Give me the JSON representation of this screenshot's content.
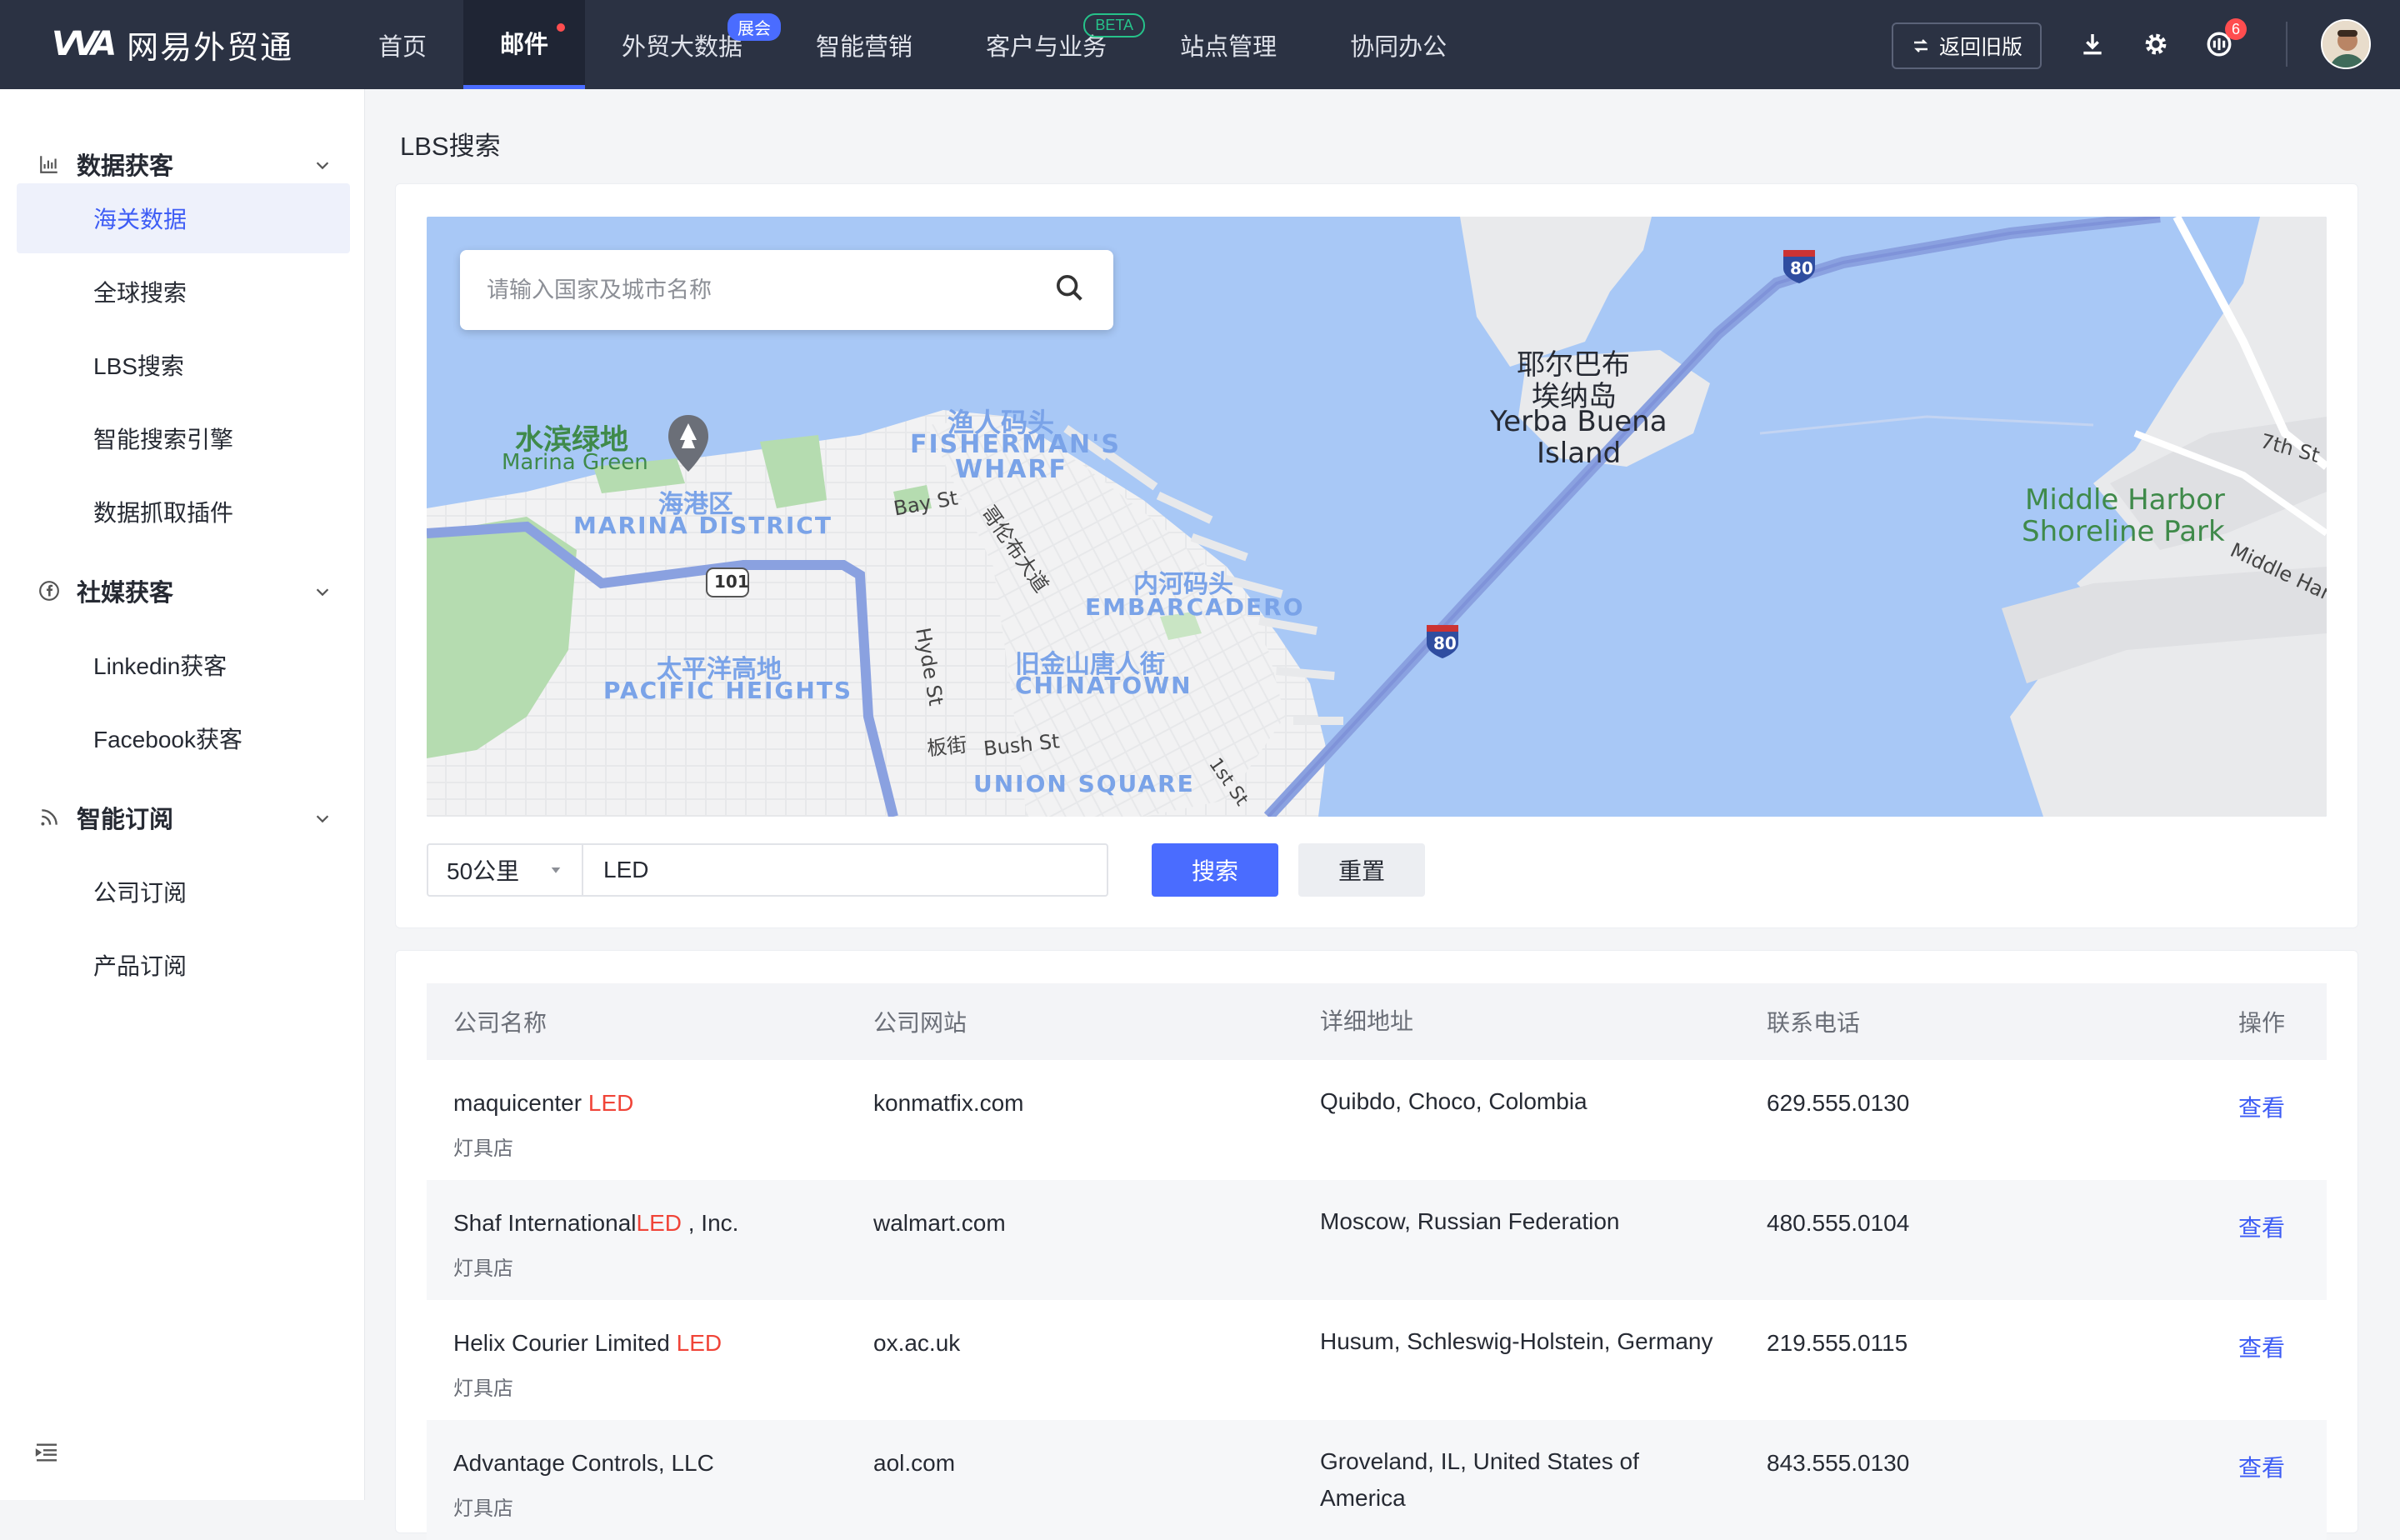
{
  "brand": {
    "logo_mark": "VVA",
    "name": "网易外贸通"
  },
  "nav": [
    {
      "label": "首页"
    },
    {
      "label": "邮件"
    },
    {
      "label": "外贸大数据",
      "badge": "展会"
    },
    {
      "label": "智能营销"
    },
    {
      "label": "客户与业务",
      "badge": "BETA"
    },
    {
      "label": "站点管理"
    },
    {
      "label": "协同办公"
    }
  ],
  "topbar": {
    "back_old_label": "返回旧版",
    "notification_count": "6"
  },
  "sidebar": {
    "groups": [
      {
        "title": "数据获客",
        "items": [
          "海关数据",
          "全球搜索",
          "LBS搜索",
          "智能搜索引擎",
          "数据抓取插件"
        ]
      },
      {
        "title": "社媒获客",
        "items": [
          "Linkedin获客",
          "Facebook获客"
        ]
      },
      {
        "title": "智能订阅",
        "items": [
          "公司订阅",
          "产品订阅"
        ]
      }
    ]
  },
  "page": {
    "title": "LBS搜索"
  },
  "map": {
    "search_placeholder": "请输入国家及城市名称",
    "labels": {
      "marina_green_cn": "水滨绿地",
      "marina_green_en": "Marina Green",
      "fishermans_cn": "渔人码头",
      "fishermans_en1": "FISHERMAN'S",
      "fishermans_en2": "WHARF",
      "marina_cn": "海港区",
      "marina_en": "MARINA DISTRICT",
      "bay_st": "Bay St",
      "columbus": "哥伦布大道",
      "embarcadero_cn": "内河码头",
      "embarcadero_en": "EMBARCADERO",
      "pacific_cn": "太平洋高地",
      "pacific_en": "PACIFIC HEIGHTS",
      "hyde_st": "Hyde St",
      "chinatown_cn": "旧金山唐人街",
      "chinatown_en": "CHINATOWN",
      "bush_cn": "板街",
      "bush_en": "Bush St",
      "union_en": "UNION SQUARE",
      "first_st": "1st St",
      "yerba_cn1": "耶尔巴布",
      "yerba_cn2": "埃纳岛",
      "yerba_en1": "Yerba Buena",
      "yerba_en2": "Island",
      "middle_harbor1": "Middle Harbor",
      "middle_harbor2": "Shoreline Park",
      "seventh_st": "7th St",
      "middle_har": "Middle Har",
      "hw101": "101",
      "hw80": "80"
    }
  },
  "filters": {
    "radius": "50公里",
    "keyword": "LED",
    "search_label": "搜索",
    "reset_label": "重置"
  },
  "table": {
    "headers": [
      "公司名称",
      "公司网站",
      "详细地址",
      "联系电话",
      "操作"
    ],
    "rows": [
      {
        "name_prefix": "maquicenter ",
        "name_hl": "LED",
        "name_suffix": "",
        "category": "灯具店",
        "website": "konmatfix.com",
        "address": "Quibdo, Choco, Colombia",
        "phone": "629.555.0130",
        "action": "查看"
      },
      {
        "name_prefix": "Shaf International",
        "name_hl": "LED",
        "name_suffix": " , Inc.",
        "category": "灯具店",
        "website": "walmart.com",
        "address": "Moscow, Russian Federation",
        "phone": "480.555.0104",
        "action": "查看"
      },
      {
        "name_prefix": "Helix Courier Limited ",
        "name_hl": "LED",
        "name_suffix": "",
        "category": "灯具店",
        "website": "ox.ac.uk",
        "address": "Husum, Schleswig-Holstein, Germany",
        "phone": "219.555.0115",
        "action": "查看"
      },
      {
        "name_prefix": "Advantage Controls, LLC",
        "name_hl": "",
        "name_suffix": "",
        "category": "灯具店",
        "website": "aol.com",
        "address": "Groveland, IL, United States of America",
        "phone": "843.555.0130",
        "action": "查看"
      }
    ]
  },
  "colors": {
    "topbar": "#2b3243",
    "accent": "#4a6cff",
    "highlight": "#f04438",
    "water": "#a8c8f6",
    "land": "#ececec",
    "park": "#b5dcb0"
  }
}
